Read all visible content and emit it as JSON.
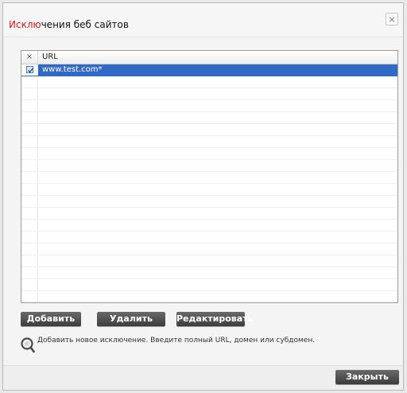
{
  "window": {
    "title_accent": "Исклю",
    "title_rest": "чения беб сайтов",
    "close_glyph": "×"
  },
  "grid": {
    "header": {
      "check_col": "×",
      "url_col": "URL"
    },
    "rows": [
      {
        "checked": true,
        "url": "www.test.com*",
        "selected": true
      }
    ],
    "empty_rows": 20
  },
  "buttons": {
    "add": "Добавить",
    "delete": "Удалить",
    "edit": "Редактировать",
    "close": "Закрыть"
  },
  "info": {
    "icon": "search-info-icon",
    "text": "Добавить новое исключение. Введите полный URL, домен или субдомен."
  },
  "colors": {
    "accent": "#e0161b",
    "selection": "#316ac5"
  }
}
